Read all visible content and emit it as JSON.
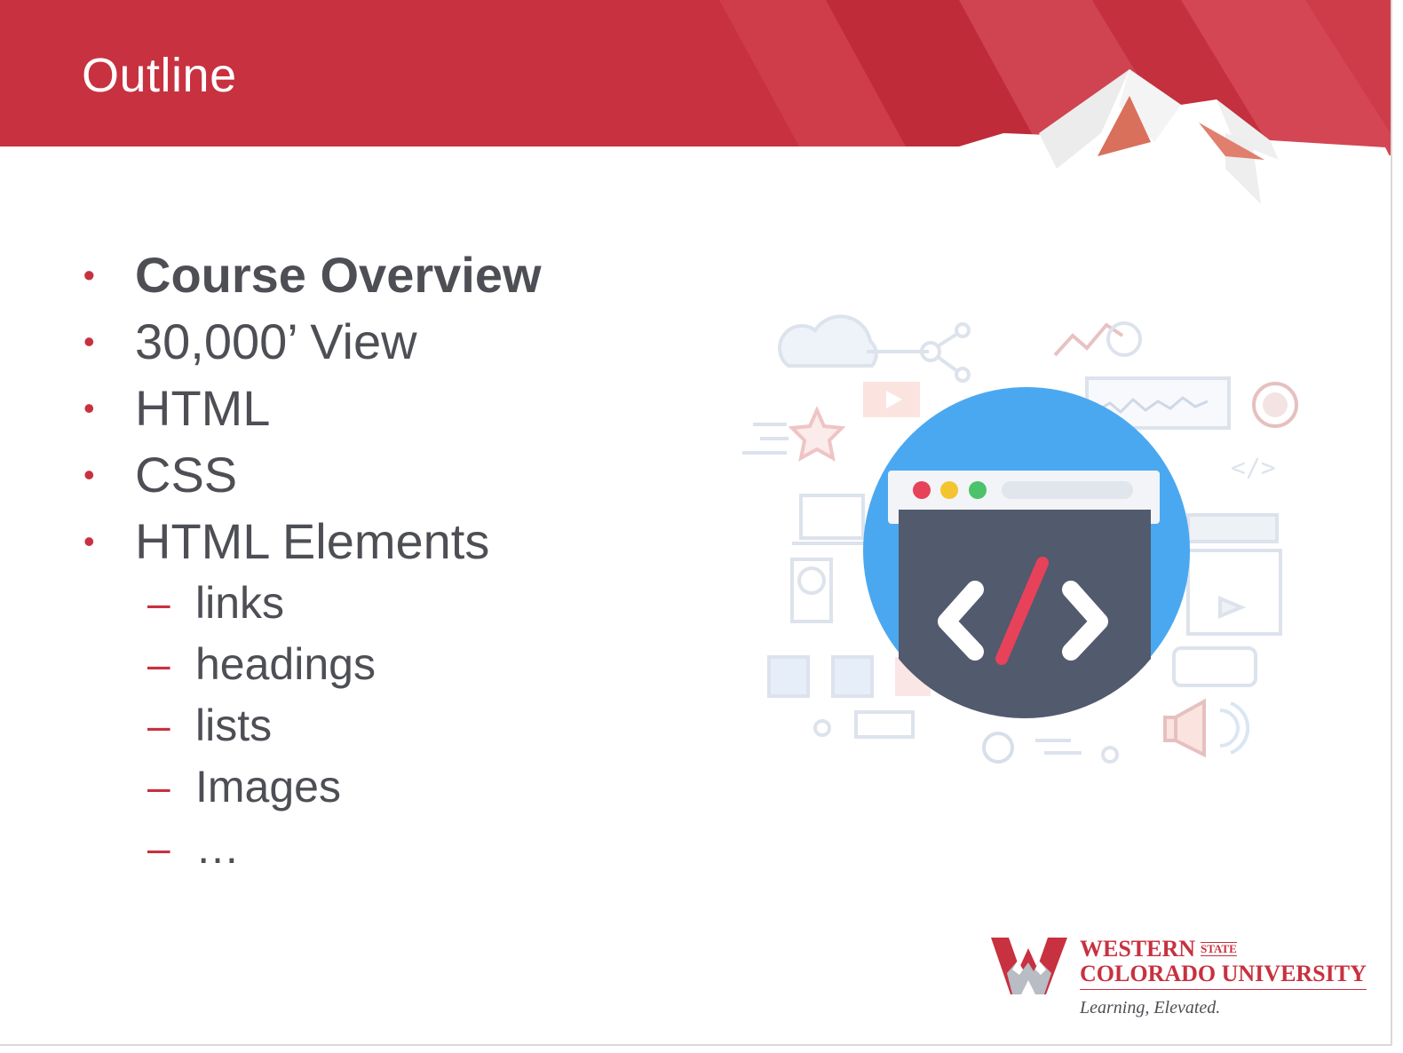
{
  "slide": {
    "title": "Outline",
    "bullets": [
      {
        "label": "Course Overview",
        "bold": true
      },
      {
        "label": "30,000’ View"
      },
      {
        "label": "HTML"
      },
      {
        "label": "CSS"
      },
      {
        "label": "HTML Elements"
      }
    ],
    "bullet_glyph": "•",
    "sub_items": [
      "links",
      "headings",
      "lists",
      "Images",
      "…"
    ],
    "sub_glyph": "–"
  },
  "illustration": {
    "code_symbol_icon": "code-tag-icon",
    "window_dots": [
      "#e8415a",
      "#f4c430",
      "#4cc26b"
    ]
  },
  "logo": {
    "western": "WESTERN",
    "state": "STATE",
    "university": "COLORADO UNIVERSITY",
    "tagline": "Learning, Elevated."
  },
  "colors": {
    "brand_red": "#c8313f",
    "text_gray": "#4d4f55",
    "circle_blue": "#4aa8f0",
    "screen_dark": "#525a6e"
  }
}
